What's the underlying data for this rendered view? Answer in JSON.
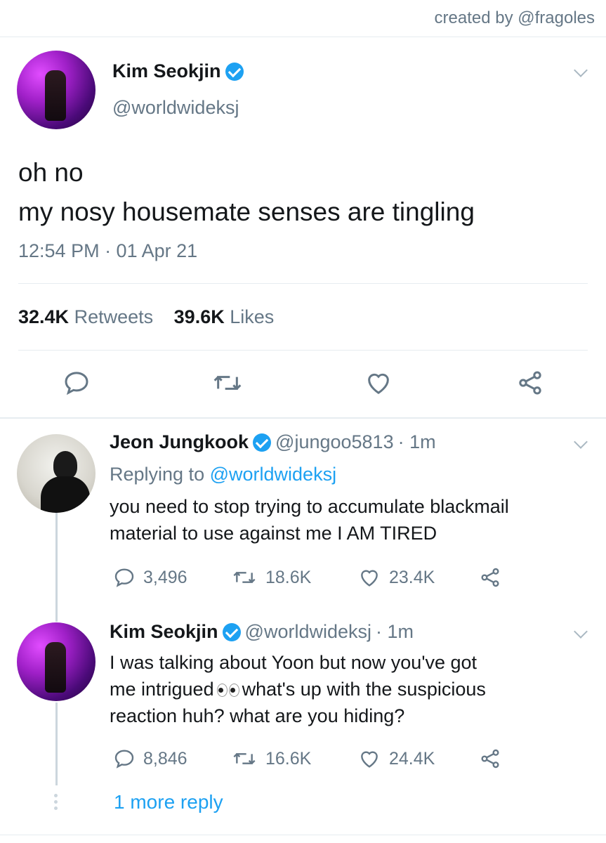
{
  "credit": "created by @fragoles",
  "main_tweet": {
    "name": "Kim Seokjin",
    "handle": "@worldwideksj",
    "text_lines": [
      "oh no",
      "my nosy housemate senses are tingling"
    ],
    "timestamp": "12:54 PM · 01 Apr 21",
    "retweets_count": "32.4K",
    "retweets_label": "Retweets",
    "likes_count": "39.6K",
    "likes_label": "Likes"
  },
  "replies": [
    {
      "name": "Jeon Jungkook",
      "handle": "@jungoo5813",
      "time": "· 1m",
      "replying_prefix": "Replying to",
      "replying_handle": "@worldwideksj",
      "text_lines": [
        "you need to stop trying to accumulate blackmail",
        "material to use against me I AM TIRED"
      ],
      "replies": "3,496",
      "retweets": "18.6K",
      "likes": "23.4K"
    },
    {
      "name": "Kim Seokjin",
      "handle": "@worldwideksj",
      "time": "· 1m",
      "text_line1": "I was talking about Yoon but now you've got",
      "text_line2_before": "me intrigued",
      "text_line2_after": "what's up with the suspicious",
      "text_line3": "reaction huh? what are you hiding?",
      "replies": "8,846",
      "retweets": "16.6K",
      "likes": "24.4K"
    }
  ],
  "more_replies": "1 more reply",
  "colors": {
    "accent": "#1da1f2",
    "secondary_text": "#657786",
    "divider": "#e6ecf0"
  },
  "icons": [
    "verified-badge-icon",
    "chevron-down-icon",
    "reply-icon",
    "retweet-icon",
    "like-icon",
    "share-icon",
    "eyes-emoji"
  ]
}
